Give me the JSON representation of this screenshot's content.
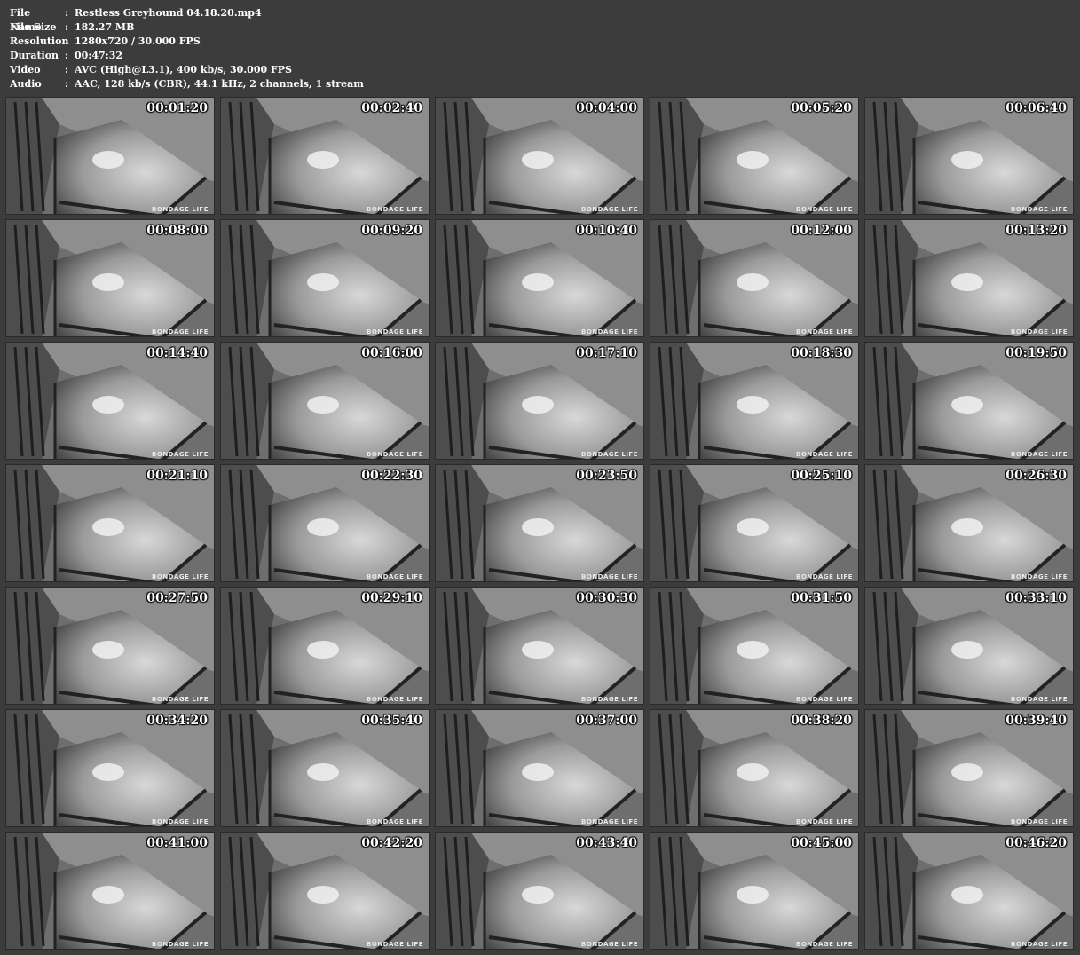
{
  "info": [
    {
      "label": "File Name",
      "value": "Restless Greyhound 04.18.20.mp4"
    },
    {
      "label": "File Size",
      "value": "182.27 MB"
    },
    {
      "label": "Resolution",
      "value": "1280x720 / 30.000 FPS"
    },
    {
      "label": "Duration",
      "value": "00:47:32"
    },
    {
      "label": "Video",
      "value": "AVC (High@L3.1), 400 kb/s, 30.000 FPS"
    },
    {
      "label": "Audio",
      "value": "AAC, 128 kb/s (CBR), 44.1 kHz, 2 channels, 1 stream"
    }
  ],
  "separator": ":",
  "watermark": "BONDAGE LIFE",
  "thumbnails": [
    "00:01:20",
    "00:02:40",
    "00:04:00",
    "00:05:20",
    "00:06:40",
    "00:08:00",
    "00:09:20",
    "00:10:40",
    "00:12:00",
    "00:13:20",
    "00:14:40",
    "00:16:00",
    "00:17:10",
    "00:18:30",
    "00:19:50",
    "00:21:10",
    "00:22:30",
    "00:23:50",
    "00:25:10",
    "00:26:30",
    "00:27:50",
    "00:29:10",
    "00:30:30",
    "00:31:50",
    "00:33:10",
    "00:34:20",
    "00:35:40",
    "00:37:00",
    "00:38:20",
    "00:39:40",
    "00:41:00",
    "00:42:20",
    "00:43:40",
    "00:45:00",
    "00:46:20"
  ]
}
